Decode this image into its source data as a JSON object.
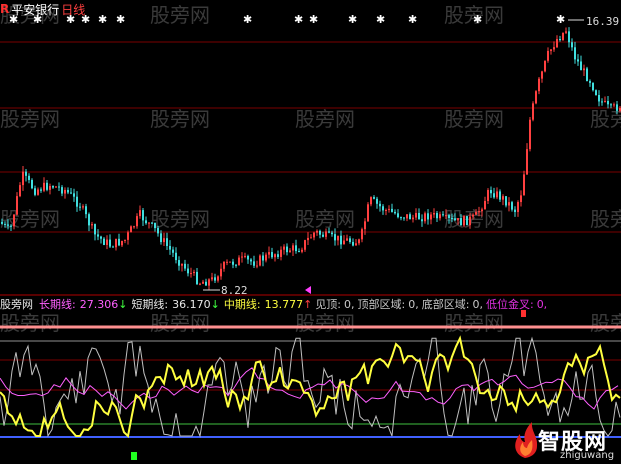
{
  "header": {
    "badge": "R",
    "stock_name": "平安银行",
    "period": "日线"
  },
  "price_labels": {
    "peak": "16.39",
    "low": "8.22"
  },
  "indicator": {
    "name": "股旁网",
    "items": [
      {
        "label": "长期线:",
        "value": "27.306",
        "arrow": "↓"
      },
      {
        "label": "短期线:",
        "value": "36.170",
        "arrow": "↓"
      },
      {
        "label": "中期线:",
        "value": "13.777",
        "arrow": "↑"
      },
      {
        "label": "见顶:",
        "value": "0,"
      },
      {
        "label": "顶部区域:",
        "value": "0,"
      },
      {
        "label": "底部区域:",
        "value": "0,"
      },
      {
        "label": "低位金叉:",
        "value": "0,"
      }
    ]
  },
  "watermark": "股旁网",
  "logo": {
    "text": "智股网",
    "sub": "zhiguwang"
  },
  "colors": {
    "background": "#000000",
    "rise": "#ff4040",
    "fall": "#40e0e0",
    "long_line": "#ff60ff",
    "short_line": "#c0c0c0",
    "mid_line": "#ffff40",
    "top_band": "#ff9090",
    "green_line": "#40c040",
    "blue_line": "#4060ff"
  }
}
